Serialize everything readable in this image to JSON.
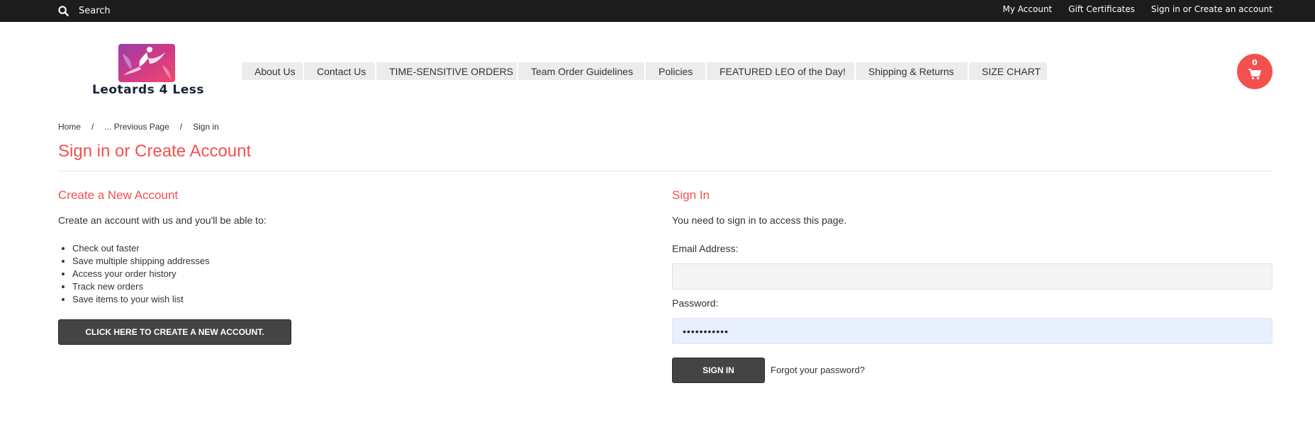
{
  "topbar": {
    "search_label": "Search",
    "links": [
      "My Account",
      "Gift Certificates",
      "Sign in or Create an account"
    ]
  },
  "header": {
    "logo_text": "Leotards 4 Less",
    "nav": [
      "About Us",
      "Contact Us",
      "TIME-SENSITIVE ORDERS",
      "Team Order Guidelines",
      "Policies",
      "FEATURED LEO of the Day!",
      "Shipping & Returns",
      "SIZE CHART"
    ],
    "cart_count": "0"
  },
  "breadcrumb": [
    "Home",
    "... Previous Page",
    "Sign in"
  ],
  "breadcrumb_separator": "/",
  "page_title": "Sign in or Create Account",
  "create": {
    "heading": "Create a New Account",
    "intro": "Create an account with us and you'll be able to:",
    "benefits": [
      "Check out faster",
      "Save multiple shipping addresses",
      "Access your order history",
      "Track new orders",
      "Save items to your wish list"
    ],
    "button_label": "CLICK HERE TO CREATE A NEW ACCOUNT."
  },
  "signin": {
    "heading": "Sign In",
    "intro": "You need to sign in to access this page.",
    "email_label": "Email Address:",
    "email_value": "",
    "password_label": "Password:",
    "password_value": "•••••••••••",
    "button_label": "SIGN IN",
    "forgot_label": "Forgot your password?"
  },
  "colors": {
    "accent": "#f4504f",
    "topbar": "#1c1c1c",
    "button": "#444444",
    "autofill": "#e8f0fe"
  }
}
